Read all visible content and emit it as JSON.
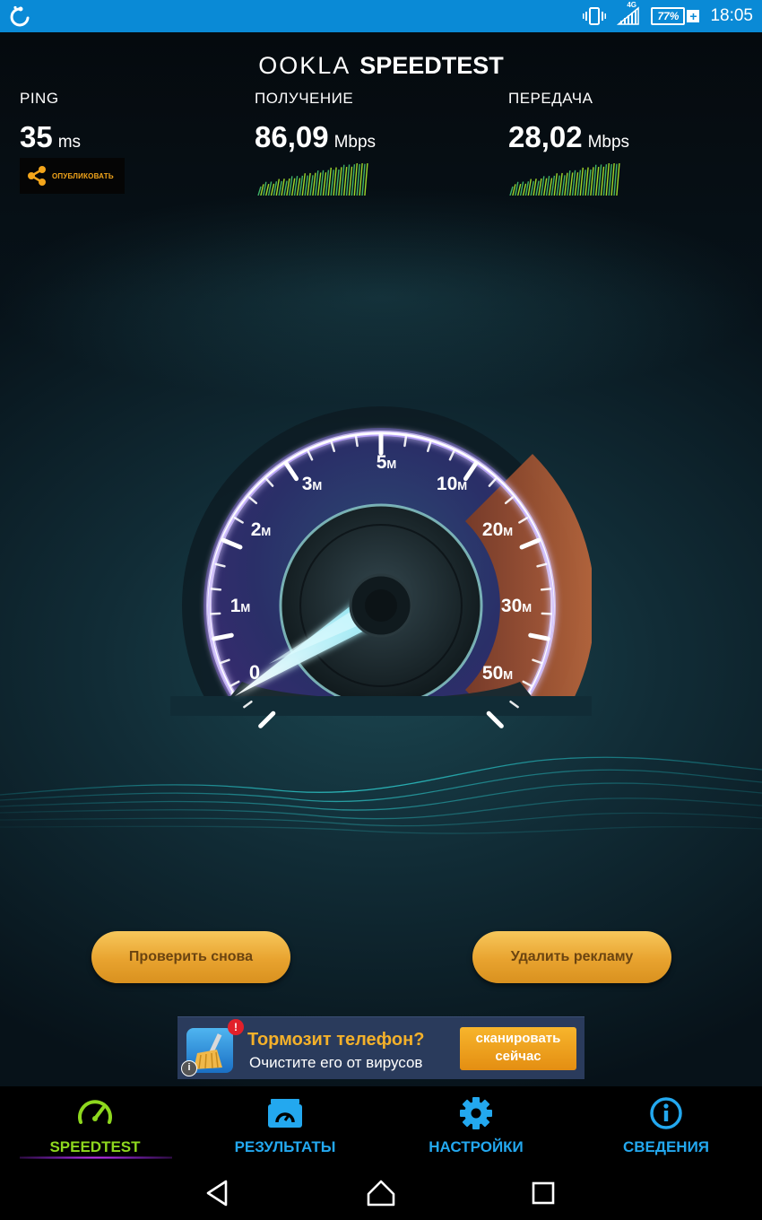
{
  "status_bar": {
    "time": "18:05",
    "battery": "77%",
    "network": "4G",
    "icons": [
      "sync-icon",
      "vibrate-icon",
      "signal-icon",
      "battery-icon"
    ]
  },
  "header": {
    "brand_ookla": "OOKLA",
    "brand_speedtest": "SPEEDTEST"
  },
  "results": {
    "ping": {
      "label": "PING",
      "value": "35",
      "unit": "ms"
    },
    "download": {
      "label": "ПОЛУЧЕНИЕ",
      "value": "86,09",
      "unit": "Mbps"
    },
    "upload": {
      "label": "ПЕРЕДАЧА",
      "value": "28,02",
      "unit": "Mbps"
    },
    "share_label": "ОПУБЛИКОВАТЬ"
  },
  "gauge": {
    "ticks": [
      {
        "num": "0",
        "unit": ""
      },
      {
        "num": "1",
        "unit": "M"
      },
      {
        "num": "2",
        "unit": "M"
      },
      {
        "num": "3",
        "unit": "M"
      },
      {
        "num": "5",
        "unit": "M"
      },
      {
        "num": "10",
        "unit": "M"
      },
      {
        "num": "20",
        "unit": "M"
      },
      {
        "num": "30",
        "unit": "M"
      },
      {
        "num": "50",
        "unit": "M"
      }
    ],
    "needle_value": "0"
  },
  "actions": {
    "retest": "Проверить снова",
    "remove_ads": "Удалить рекламу"
  },
  "ad": {
    "badge": "!",
    "headline": "Тормозит телефон?",
    "subline": "Очистите его от вирусов",
    "cta_line1": "сканировать",
    "cta_line2": "сейчас",
    "info": "i"
  },
  "nav": {
    "speedtest": "SPEEDTEST",
    "results": "РЕЗУЛЬТАТЫ",
    "settings": "НАСТРОЙКИ",
    "about": "СВЕДЕНИЯ"
  },
  "colors": {
    "status_bar": "#0a8ad6",
    "accent_green": "#8ed81e",
    "accent_blue": "#23a8ef",
    "gold": "#e8a32f"
  }
}
